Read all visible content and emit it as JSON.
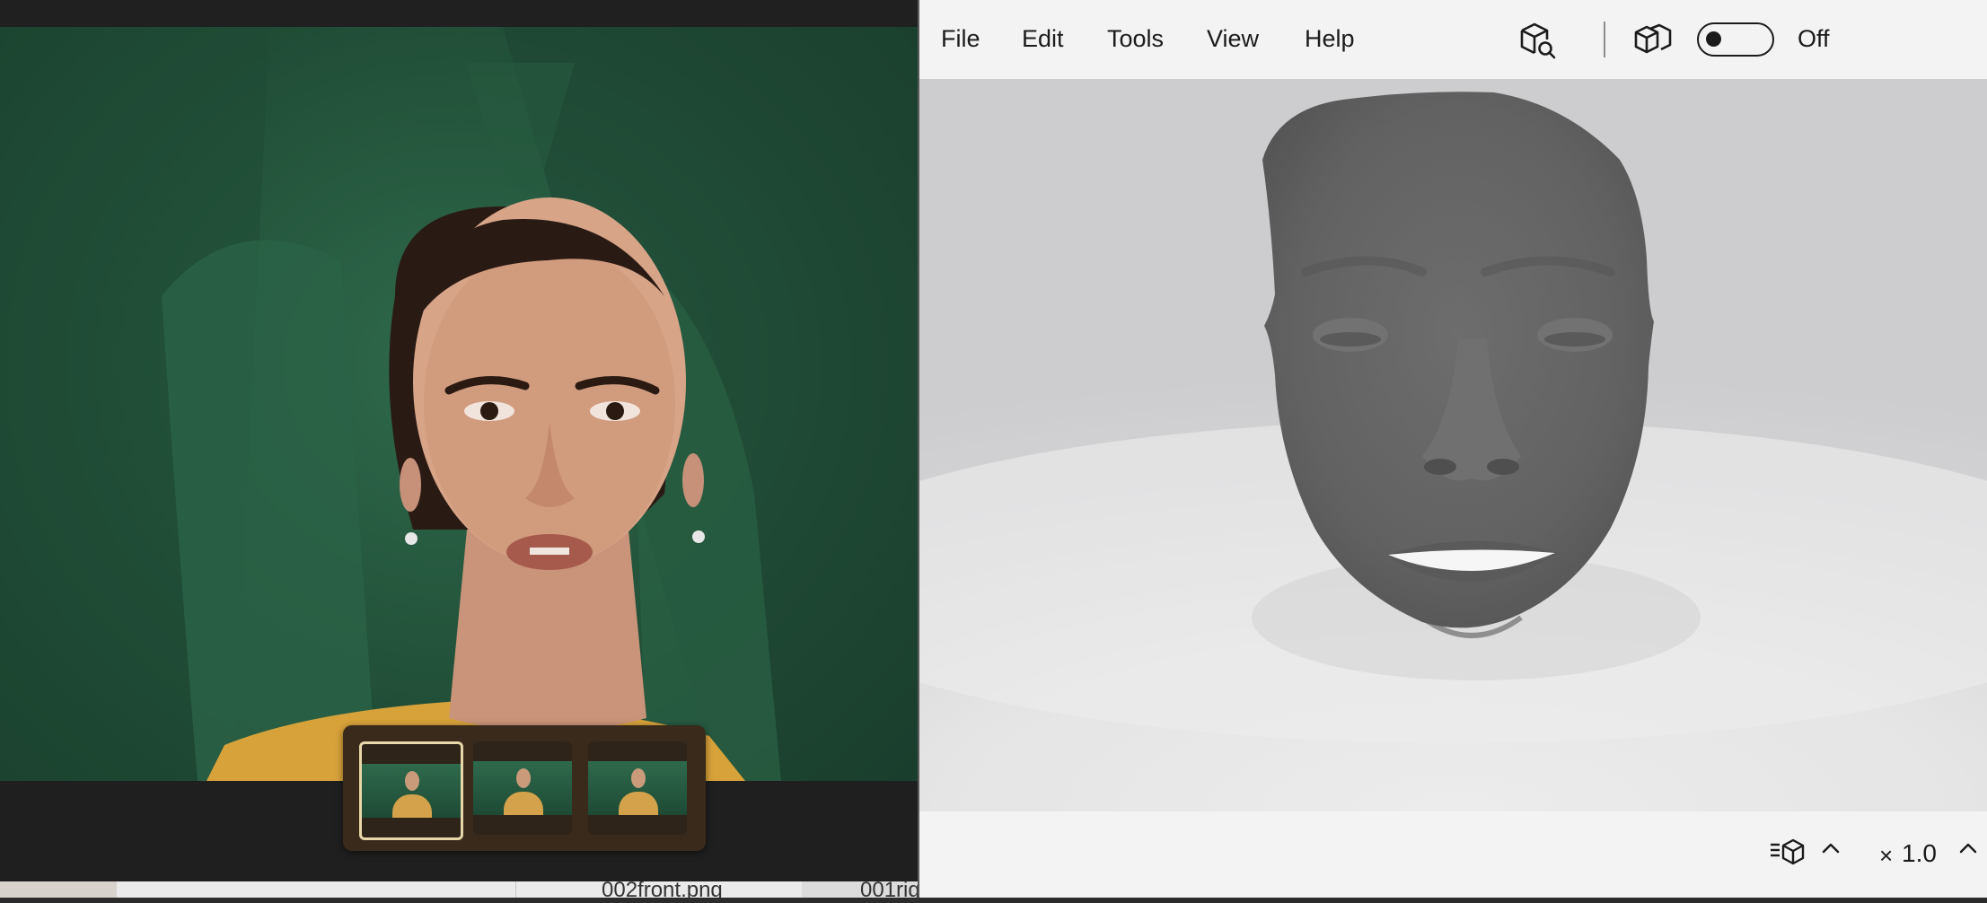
{
  "photo_viewer": {
    "thumbnails": [
      {
        "name": "thumbnail-front",
        "selected": true
      },
      {
        "name": "thumbnail-left",
        "selected": false
      },
      {
        "name": "thumbnail-right",
        "selected": false
      }
    ]
  },
  "desktop": {
    "files": [
      "002front.png",
      "001rig"
    ]
  },
  "app3d": {
    "menu": [
      "File",
      "Edit",
      "Tools",
      "View",
      "Help"
    ],
    "toolbar": {
      "icons": [
        "cube-search-icon",
        "cubes-icon"
      ],
      "toggle_state": "Off"
    },
    "status": {
      "icon": "mesh-list-icon",
      "zoom_prefix": "×",
      "zoom_value": "1.0"
    }
  }
}
